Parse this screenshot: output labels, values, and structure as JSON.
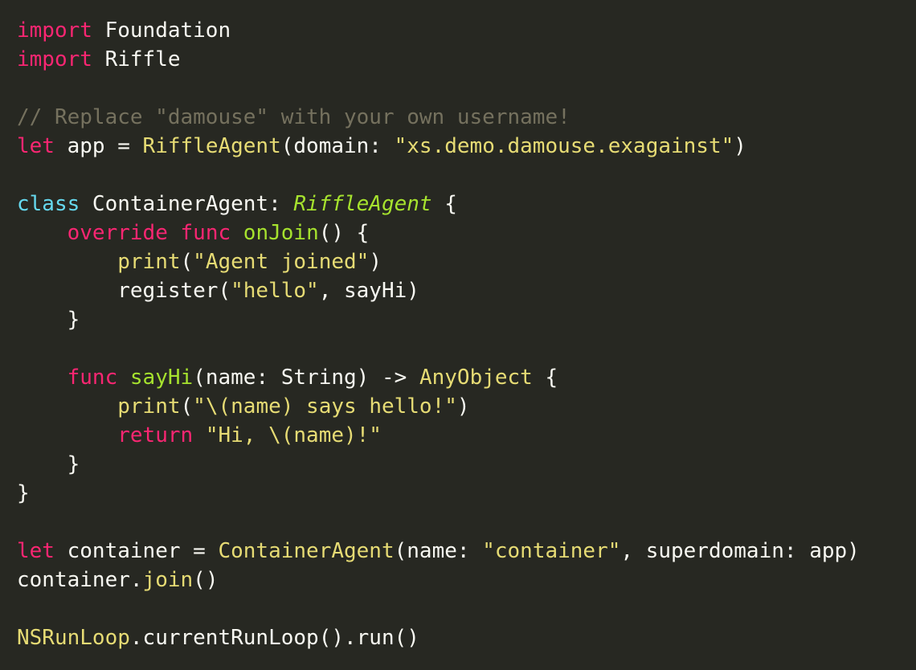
{
  "theme": {
    "background": "#272822",
    "foreground": "#F8F8F2",
    "keyword": "#F92672",
    "keyword_decl": "#66D9EF",
    "function_name": "#A6E22E",
    "string": "#E6DB74",
    "comment": "#75715E"
  },
  "lines": [
    [
      {
        "t": "import",
        "c": "kw"
      },
      {
        "t": " Foundation",
        "c": "plain"
      }
    ],
    [
      {
        "t": "import",
        "c": "kw"
      },
      {
        "t": " Riffle",
        "c": "plain"
      }
    ],
    [],
    [
      {
        "t": "// Replace \"damouse\" with your own username!",
        "c": "cm"
      }
    ],
    [
      {
        "t": "let",
        "c": "kw"
      },
      {
        "t": " app = ",
        "c": "plain"
      },
      {
        "t": "RiffleAgent",
        "c": "call"
      },
      {
        "t": "(domain: ",
        "c": "plain"
      },
      {
        "t": "\"xs.demo.damouse.exagainst\"",
        "c": "str"
      },
      {
        "t": ")",
        "c": "plain"
      }
    ],
    [],
    [
      {
        "t": "class",
        "c": "kw-b"
      },
      {
        "t": " ContainerAgent: ",
        "c": "plain"
      },
      {
        "t": "RiffleAgent",
        "c": "ty-i"
      },
      {
        "t": " {",
        "c": "plain"
      }
    ],
    [
      {
        "t": "    ",
        "c": "plain"
      },
      {
        "t": "override",
        "c": "kw"
      },
      {
        "t": " ",
        "c": "plain"
      },
      {
        "t": "func",
        "c": "kw"
      },
      {
        "t": " ",
        "c": "plain"
      },
      {
        "t": "onJoin",
        "c": "fn"
      },
      {
        "t": "() {",
        "c": "plain"
      }
    ],
    [
      {
        "t": "        ",
        "c": "plain"
      },
      {
        "t": "print",
        "c": "call"
      },
      {
        "t": "(",
        "c": "plain"
      },
      {
        "t": "\"Agent joined\"",
        "c": "str"
      },
      {
        "t": ")",
        "c": "plain"
      }
    ],
    [
      {
        "t": "        register(",
        "c": "plain"
      },
      {
        "t": "\"hello\"",
        "c": "str"
      },
      {
        "t": ", sayHi)",
        "c": "plain"
      }
    ],
    [
      {
        "t": "    }",
        "c": "plain"
      }
    ],
    [],
    [
      {
        "t": "    ",
        "c": "plain"
      },
      {
        "t": "func",
        "c": "kw"
      },
      {
        "t": " ",
        "c": "plain"
      },
      {
        "t": "sayHi",
        "c": "fn"
      },
      {
        "t": "(name: String) -> ",
        "c": "plain"
      },
      {
        "t": "AnyObject",
        "c": "ty"
      },
      {
        "t": " {",
        "c": "plain"
      }
    ],
    [
      {
        "t": "        ",
        "c": "plain"
      },
      {
        "t": "print",
        "c": "call"
      },
      {
        "t": "(",
        "c": "plain"
      },
      {
        "t": "\"\\(name) says hello!\"",
        "c": "str"
      },
      {
        "t": ")",
        "c": "plain"
      }
    ],
    [
      {
        "t": "        ",
        "c": "plain"
      },
      {
        "t": "return",
        "c": "kw"
      },
      {
        "t": " ",
        "c": "plain"
      },
      {
        "t": "\"Hi, \\(name)!\"",
        "c": "str"
      }
    ],
    [
      {
        "t": "    }",
        "c": "plain"
      }
    ],
    [
      {
        "t": "}",
        "c": "plain"
      }
    ],
    [],
    [
      {
        "t": "let",
        "c": "kw"
      },
      {
        "t": " container = ",
        "c": "plain"
      },
      {
        "t": "ContainerAgent",
        "c": "call"
      },
      {
        "t": "(name: ",
        "c": "plain"
      },
      {
        "t": "\"container\"",
        "c": "str"
      },
      {
        "t": ", superdomain: app)",
        "c": "plain"
      }
    ],
    [
      {
        "t": "container.",
        "c": "plain"
      },
      {
        "t": "join",
        "c": "call"
      },
      {
        "t": "()",
        "c": "plain"
      }
    ],
    [],
    [
      {
        "t": "NSRunLoop",
        "c": "call"
      },
      {
        "t": ".currentRunLoop().run()",
        "c": "plain"
      }
    ]
  ]
}
